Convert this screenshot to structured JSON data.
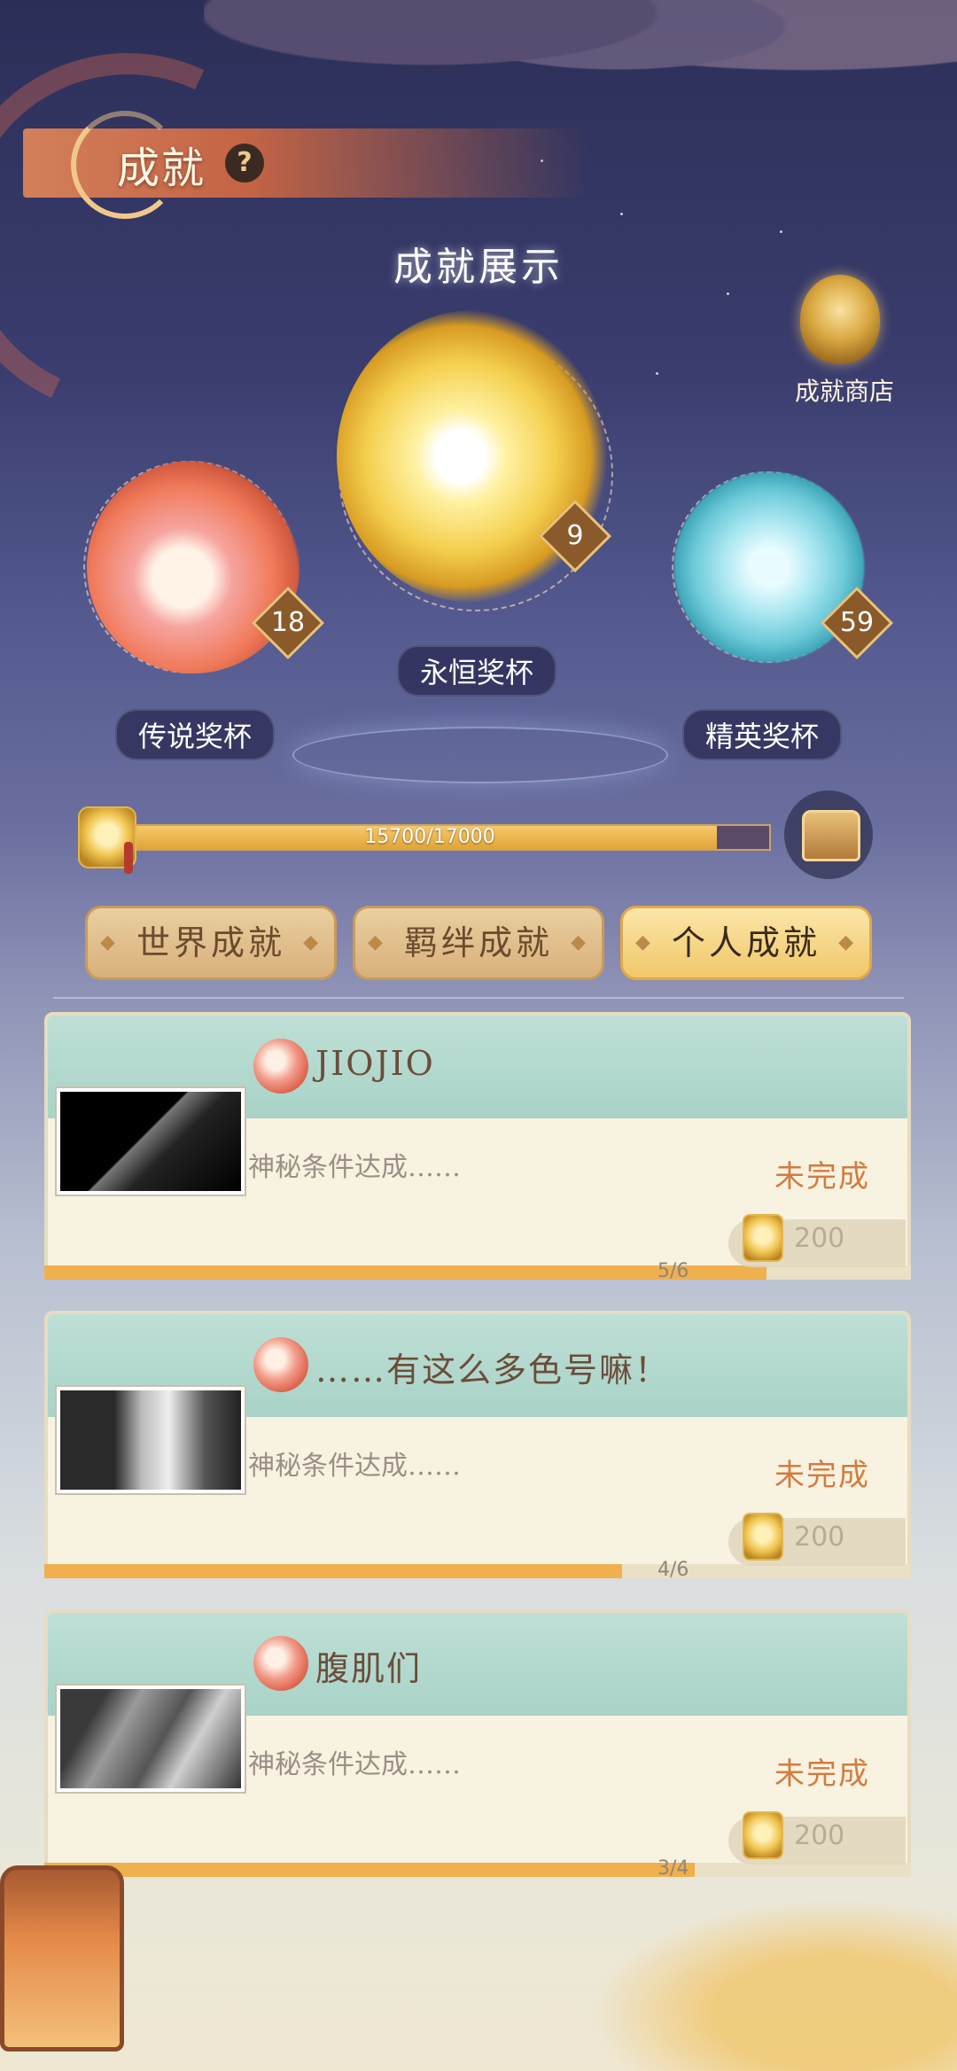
{
  "header": {
    "title": "成就",
    "help_icon": "?"
  },
  "showcase": {
    "title": "成就展示"
  },
  "shop": {
    "label": "成就商店"
  },
  "trophies": [
    {
      "label": "传说奖杯",
      "count": "18",
      "color": "#f07a5a"
    },
    {
      "label": "永恒奖杯",
      "count": "9",
      "color": "#f4cf4e"
    },
    {
      "label": "精英奖杯",
      "count": "59",
      "color": "#6cc9d8"
    }
  ],
  "progress": {
    "text": "15700/17000",
    "current": 15700,
    "max": 17000
  },
  "tabs": [
    {
      "label": "世界成就",
      "active": false
    },
    {
      "label": "羁绊成就",
      "active": false
    },
    {
      "label": "个人成就",
      "active": true
    }
  ],
  "achievements": [
    {
      "title": "JIOJIO",
      "desc": "神秘条件达成……",
      "status": "未完成",
      "count": "5/6",
      "progress": 0.8333,
      "reward": "200"
    },
    {
      "title": "……有这么多色号嘛！",
      "desc": "神秘条件达成……",
      "status": "未完成",
      "count": "4/6",
      "progress": 0.6667,
      "reward": "200"
    },
    {
      "title": "腹肌们",
      "desc": "神秘条件达成……",
      "status": "未完成",
      "count": "3/4",
      "progress": 0.75,
      "reward": "200"
    }
  ],
  "colors": {
    "accent": "#f0b04e",
    "status": "#d37c3e",
    "tab_active": "#f1c76a"
  }
}
